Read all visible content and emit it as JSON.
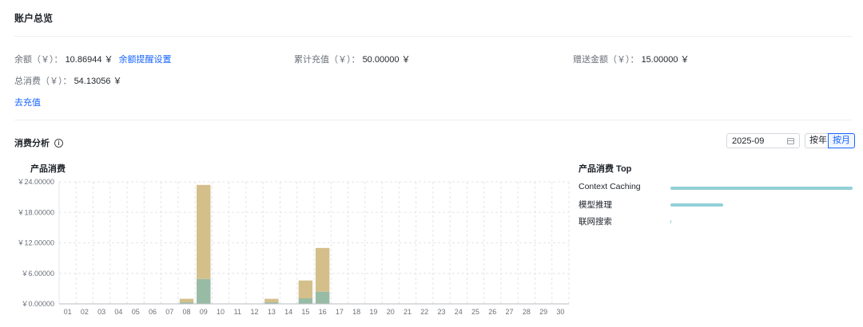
{
  "title": "账户总览",
  "summary": {
    "balance_label": "余额（￥）：",
    "balance_value": "10.86944 ￥",
    "balance_alert_link": "余额提醒设置",
    "recharge_label": "累计充值（￥）：",
    "recharge_value": "50.00000 ￥",
    "gift_label": "赠送金额（￥）：",
    "gift_value": "15.00000 ￥",
    "total_label": "总消费（￥）：",
    "total_value": "54.13056 ￥",
    "recharge_link": "去充值"
  },
  "analysis": {
    "title": "消费分析",
    "date_value": "2025-09",
    "mode_year": "按年",
    "mode_month": "按月",
    "selected_mode": "month"
  },
  "colors": {
    "series_a": "#d4bf8b",
    "series_b": "#98bba5",
    "top_bar": "#92d0d6",
    "accent": "#1664ff"
  },
  "chart_data": {
    "type": "bar",
    "stacked": true,
    "title": "产品消费",
    "y_ticks": [
      "￥0.00000",
      "￥6.00000",
      "￥12.00000",
      "￥18.00000",
      "￥24.00000"
    ],
    "ylim": [
      0,
      24
    ],
    "grid": true,
    "categories": [
      "01",
      "02",
      "03",
      "04",
      "05",
      "06",
      "07",
      "08",
      "09",
      "10",
      "11",
      "12",
      "13",
      "14",
      "15",
      "16",
      "17",
      "18",
      "19",
      "20",
      "21",
      "22",
      "23",
      "24",
      "25",
      "26",
      "27",
      "28",
      "29",
      "30"
    ],
    "series": [
      {
        "values": [
          0,
          0,
          0,
          0,
          0,
          0,
          0,
          0.3,
          4.9,
          0,
          0,
          0,
          0.3,
          0,
          1.1,
          2.4,
          0,
          0,
          0,
          0,
          0,
          0,
          0,
          0,
          0,
          0,
          0,
          0,
          0,
          0
        ]
      },
      {
        "values": [
          0,
          0,
          0,
          0,
          0,
          0,
          0,
          0.7,
          18.5,
          0,
          0,
          0,
          0.7,
          0,
          3.5,
          8.6,
          0,
          0,
          0,
          0,
          0,
          0,
          0,
          0,
          0,
          0,
          0,
          0,
          0,
          0
        ]
      }
    ]
  },
  "top": {
    "title": "产品消费 Top",
    "items": [
      {
        "label": "Context Caching",
        "value": 1.0
      },
      {
        "label": "模型推理",
        "value": 0.29
      },
      {
        "label": "联网搜索",
        "value": 0.003
      }
    ]
  }
}
